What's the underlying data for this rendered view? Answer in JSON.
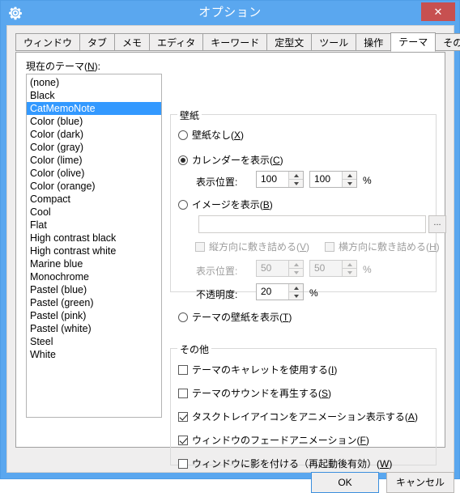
{
  "window": {
    "title": "オプション",
    "icon": "gear-icon",
    "close_label": "✕",
    "titlebar_color": "#5aa7ef",
    "close_color": "#c75050"
  },
  "tabs": [
    {
      "label": "ウィンドウ",
      "active": false
    },
    {
      "label": "タブ",
      "active": false
    },
    {
      "label": "メモ",
      "active": false
    },
    {
      "label": "エディタ",
      "active": false
    },
    {
      "label": "キーワード",
      "active": false
    },
    {
      "label": "定型文",
      "active": false
    },
    {
      "label": "ツール",
      "active": false
    },
    {
      "label": "操作",
      "active": false
    },
    {
      "label": "テーマ",
      "active": true
    },
    {
      "label": "その他",
      "active": false
    }
  ],
  "theme_panel": {
    "label_prefix": "現在のテーマ(",
    "label_accel": "N",
    "label_suffix": "):",
    "selected": "CatMemoNote",
    "selection_color": "#3399ff",
    "items": [
      "(none)",
      "Black",
      "CatMemoNote",
      "Color (blue)",
      "Color (dark)",
      "Color (gray)",
      "Color (lime)",
      "Color (olive)",
      "Color (orange)",
      "Compact",
      "Cool",
      "Flat",
      "High contrast black",
      "High contrast white",
      "Marine blue",
      "Monochrome",
      "Pastel (blue)",
      "Pastel (green)",
      "Pastel (pink)",
      "Pastel (white)",
      "Steel",
      "White"
    ]
  },
  "wallpaper_group": {
    "title": "壁紙",
    "radio_none": {
      "text": "壁紙なし(",
      "accel": "X",
      "tail": ")",
      "checked": false
    },
    "radio_calendar": {
      "text": "カレンダーを表示(",
      "accel": "C",
      "tail": ")",
      "checked": true
    },
    "calendar_position": {
      "label": "表示位置:",
      "x_value": "100",
      "y_value": "100",
      "unit": "%"
    },
    "radio_image": {
      "text": "イメージを表示(",
      "accel": "B",
      "tail": ")",
      "checked": false
    },
    "image_path": {
      "value": "",
      "placeholder": ""
    },
    "browse_label": "...",
    "tile_vertical": {
      "text": "縦方向に敷き詰める(",
      "accel": "V",
      "tail": ")",
      "checked": false,
      "enabled": false
    },
    "tile_horizontal": {
      "text": "横方向に敷き詰める(",
      "accel": "H",
      "tail": ")",
      "checked": false,
      "enabled": false
    },
    "image_position": {
      "label": "表示位置:",
      "x_value": "50",
      "y_value": "50",
      "unit": "%",
      "enabled": false
    },
    "opacity": {
      "label": "不透明度:",
      "value": "20",
      "unit": "%",
      "enabled": true
    },
    "radio_theme_wallpaper": {
      "text": "テーマの壁紙を表示(",
      "accel": "T",
      "tail": ")",
      "checked": false
    }
  },
  "other_group": {
    "title": "その他",
    "checks": [
      {
        "text": "テーマのキャレットを使用する(",
        "accel": "I",
        "tail": ")",
        "checked": false
      },
      {
        "text": "テーマのサウンドを再生する(",
        "accel": "S",
        "tail": ")",
        "checked": false
      },
      {
        "text": "タスクトレイアイコンをアニメーション表示する(",
        "accel": "A",
        "tail": ")",
        "checked": true
      },
      {
        "text": "ウィンドウのフェードアニメーション(",
        "accel": "F",
        "tail": ")",
        "checked": true
      },
      {
        "text": "ウィンドウに影を付ける（再起動後有効）(",
        "accel": "W",
        "tail": ")",
        "checked": false
      }
    ]
  },
  "footer": {
    "ok_label": "OK",
    "cancel_label": "キャンセル"
  }
}
